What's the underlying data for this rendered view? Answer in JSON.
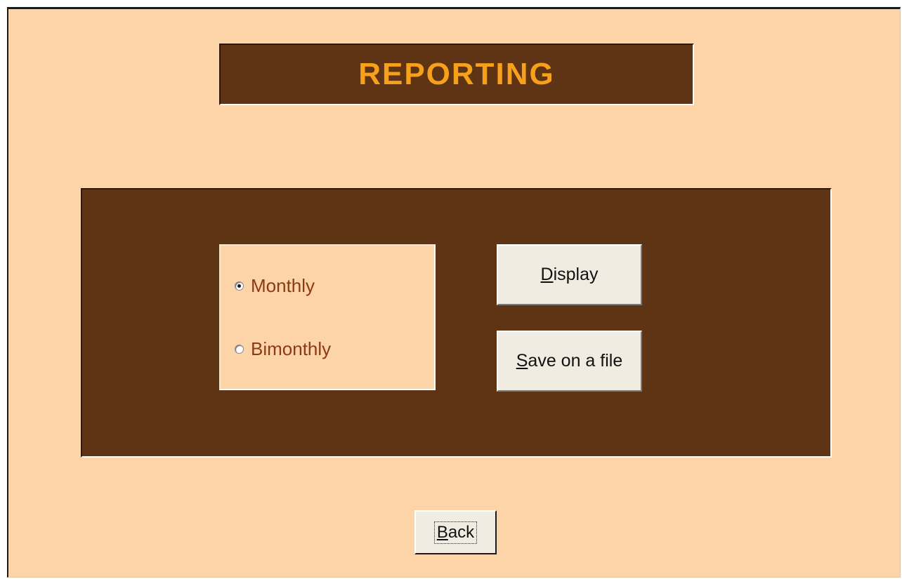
{
  "title": "REPORTING",
  "period_options": [
    {
      "label": "Monthly",
      "selected": true
    },
    {
      "label": "Bimonthly",
      "selected": false
    }
  ],
  "buttons": {
    "display": {
      "mnemonic": "D",
      "rest": "isplay"
    },
    "save": {
      "mnemonic": "S",
      "rest": "ave on a file"
    },
    "back": {
      "mnemonic": "B",
      "rest": "ack"
    }
  },
  "colors": {
    "background": "#fdd3a8",
    "panel": "#5e3414",
    "title_text": "#f6a01c",
    "option_text": "#8c3a14",
    "button_face": "#f1ece2"
  }
}
